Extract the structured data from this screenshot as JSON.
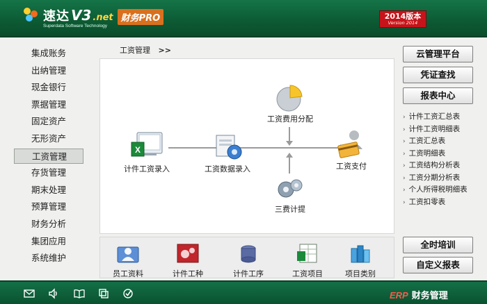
{
  "header": {
    "logo_cn": "速达",
    "logo_v3": "V3",
    "logo_net": ".net",
    "logo_sub": "Superdata Software Technology",
    "pro_badge": "财务PRO",
    "version_main": "2014版本",
    "version_sub": "Version 2014"
  },
  "menu": {
    "items": [
      {
        "label": "集成账务"
      },
      {
        "label": "出纳管理"
      },
      {
        "label": "现金银行"
      },
      {
        "label": "票据管理"
      },
      {
        "label": "固定资产"
      },
      {
        "label": "无形资产"
      },
      {
        "label": "工资管理",
        "active": true
      },
      {
        "label": "存货管理"
      },
      {
        "label": "期末处理"
      },
      {
        "label": "预算管理"
      },
      {
        "label": "财务分析"
      },
      {
        "label": "集团应用"
      },
      {
        "label": "系统维护"
      }
    ]
  },
  "breadcrumb": {
    "current": "工资管理",
    "separator": ">>"
  },
  "flow": {
    "piece_entry": "计件工资录入",
    "data_entry": "工资数据录入",
    "allocation": "工资费用分配",
    "payment": "工资支付",
    "three_fees": "三费计提"
  },
  "bottom": {
    "items": [
      "员工资料",
      "计件工种",
      "计件工序",
      "工资项目",
      "项目类别"
    ]
  },
  "right": {
    "cloud": "云管理平台",
    "voucher": "凭证查找",
    "reports": "报表中心",
    "report_items": [
      "计件工资汇总表",
      "计件工资明细表",
      "工资汇总表",
      "工资明细表",
      "工资结构分析表",
      "工资分期分析表",
      "个人所得税明细表",
      "工资扣零表"
    ],
    "training": "全时培训",
    "custom_reports": "自定义报表"
  },
  "footer": {
    "erp": "ERP",
    "brand": "财务管理",
    "icons": [
      "mail-icon",
      "speaker-icon",
      "book-icon",
      "window-icon",
      "check-icon"
    ]
  },
  "colors": {
    "header_green": "#0c5a33",
    "pro_orange": "#d9701e",
    "version_red": "#c7141b",
    "erp_red": "#ff5a4a"
  }
}
